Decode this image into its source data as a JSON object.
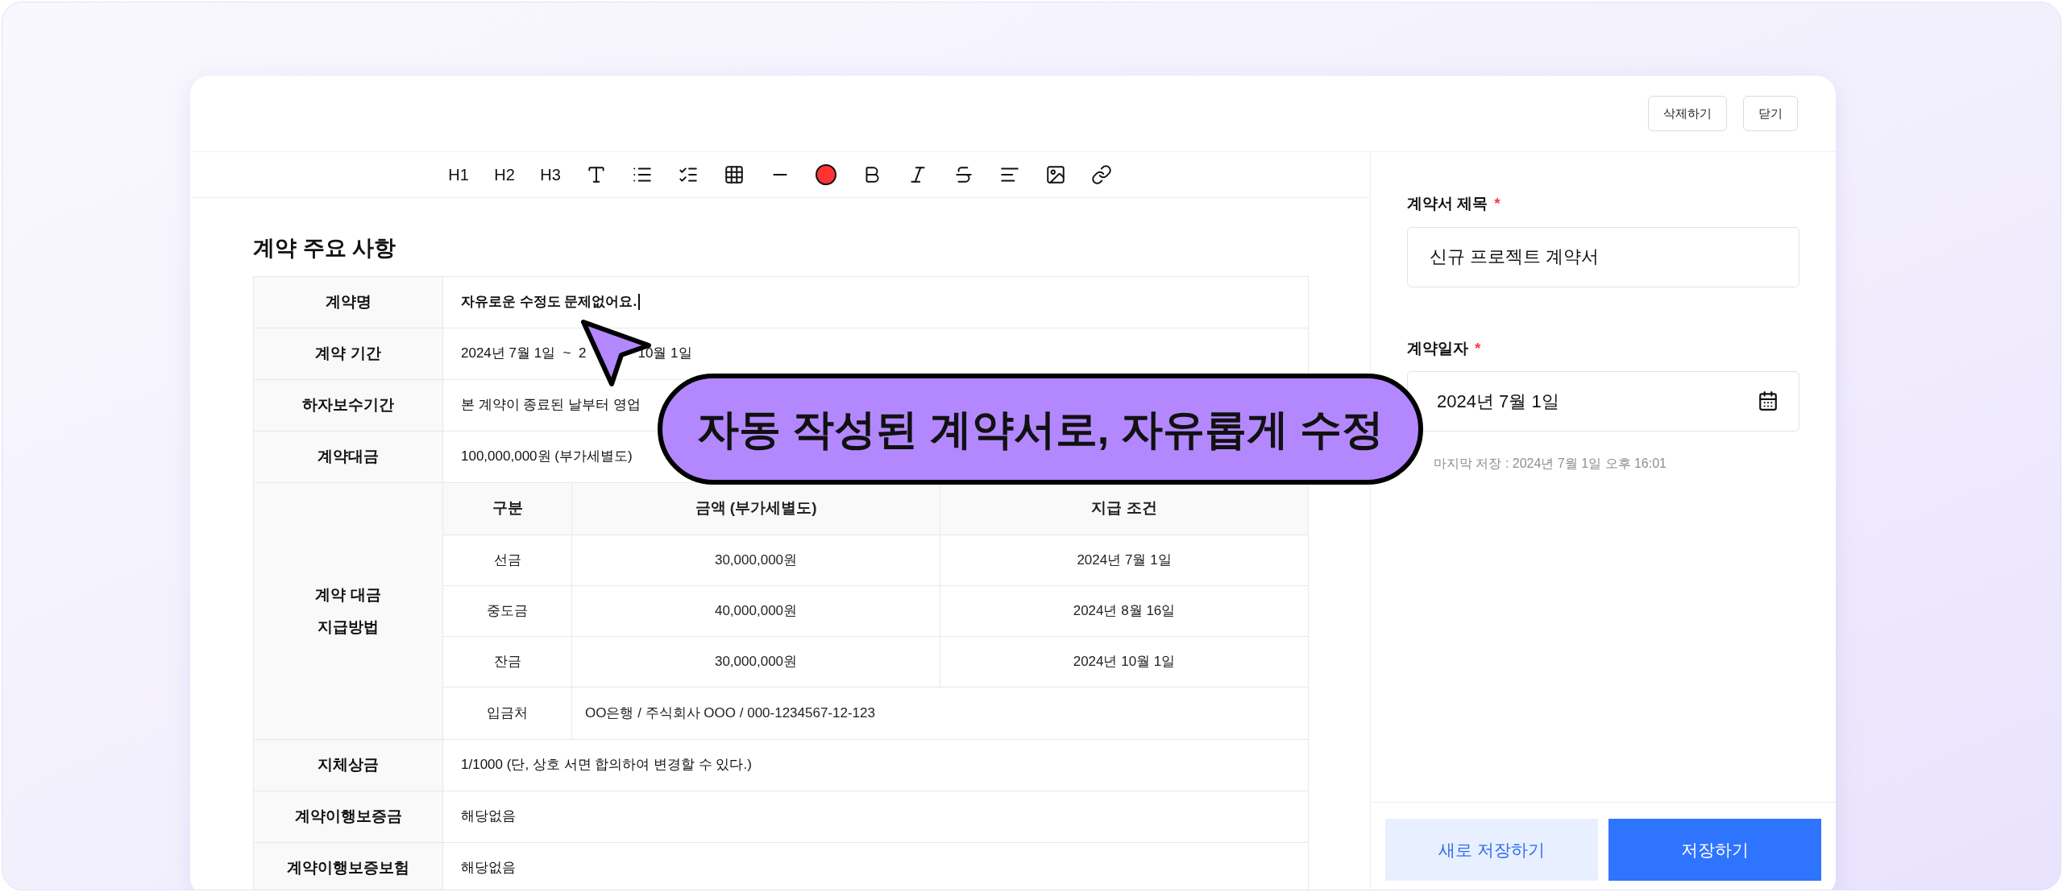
{
  "header": {
    "buttons": [
      "삭제하기",
      "닫기"
    ]
  },
  "toolbar": {
    "headings": [
      "H1",
      "H2",
      "H3"
    ],
    "color": "#ff3333"
  },
  "document": {
    "heading": "계약 주요 사항",
    "rows": [
      {
        "kind": "text",
        "label": "계약명",
        "parts": [
          "자유로운 수정도 문제없어요."
        ],
        "bold": true,
        "caret": true
      },
      {
        "kind": "text",
        "label": "계약 기간",
        "parts": [
          "2024년 7월 1일  ~  2",
          "10월 1일"
        ],
        "bold": false,
        "caret": false
      },
      {
        "kind": "text",
        "label": "하자보수기간",
        "parts": [
          "본 계약이 종료된 날부터 영업"
        ],
        "bold": false,
        "caret": false
      },
      {
        "kind": "text",
        "label": "계약대금",
        "parts": [
          "100,000,000원 (부가세별도)"
        ],
        "bold": false,
        "caret": false
      },
      {
        "kind": "payment",
        "label_lines": [
          "계약 대금",
          "지급방법"
        ],
        "columns": [
          "구분",
          "금액 (부가세별도)",
          "지급 조건"
        ],
        "rows": [
          [
            "선금",
            "30,000,000원",
            "2024년 7월 1일"
          ],
          [
            "중도금",
            "40,000,000원",
            "2024년 8월 16일"
          ],
          [
            "잔금",
            "30,000,000원",
            "2024년 10월 1일"
          ]
        ],
        "account": {
          "label": "입금처",
          "value": "OO은행 / 주식회사 OOO / 000-1234567-12-123"
        }
      },
      {
        "kind": "text",
        "label": "지체상금",
        "parts": [
          "1/1000 (단, 상호 서면 합의하여 변경할 수 있다.)"
        ],
        "bold": false,
        "caret": false
      },
      {
        "kind": "text",
        "label": "계약이행보증금",
        "parts": [
          "해당없음"
        ],
        "bold": false,
        "caret": false
      },
      {
        "kind": "text",
        "label": "계약이행보증보험",
        "parts": [
          "해당없음"
        ],
        "bold": false,
        "caret": false
      }
    ]
  },
  "callout": "자동 작성된 계약서로, 자유롭게 수정",
  "panel": {
    "fields": [
      {
        "kind": "text",
        "label": "계약서 제목",
        "required_mark": "*",
        "value": "신규 프로젝트 계약서"
      },
      {
        "kind": "date",
        "label": "계약일자",
        "required_mark": "*",
        "value": "2024년 7월 1일"
      }
    ],
    "last_saved": "마지막 저장 : 2024년 7월 1일 오후 16:01",
    "buttons": [
      {
        "kind": "secondary",
        "label": "새로 저장하기"
      },
      {
        "kind": "primary",
        "label": "저장하기"
      }
    ]
  }
}
